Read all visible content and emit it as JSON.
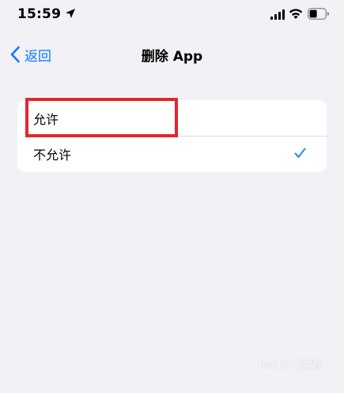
{
  "status_bar": {
    "time": "15:59",
    "icons": [
      "location-arrow-icon",
      "signal-icon",
      "wifi-icon",
      "battery-icon"
    ]
  },
  "nav": {
    "back_label": "返回",
    "title": "删除 App"
  },
  "options": [
    {
      "label": "允许",
      "selected": false
    },
    {
      "label": "不允许",
      "selected": true
    }
  ],
  "colors": {
    "accent": "#0a7aff",
    "background": "#f2f1f6",
    "highlight": "#e3262d"
  },
  "watermark": "Bai du 经验"
}
